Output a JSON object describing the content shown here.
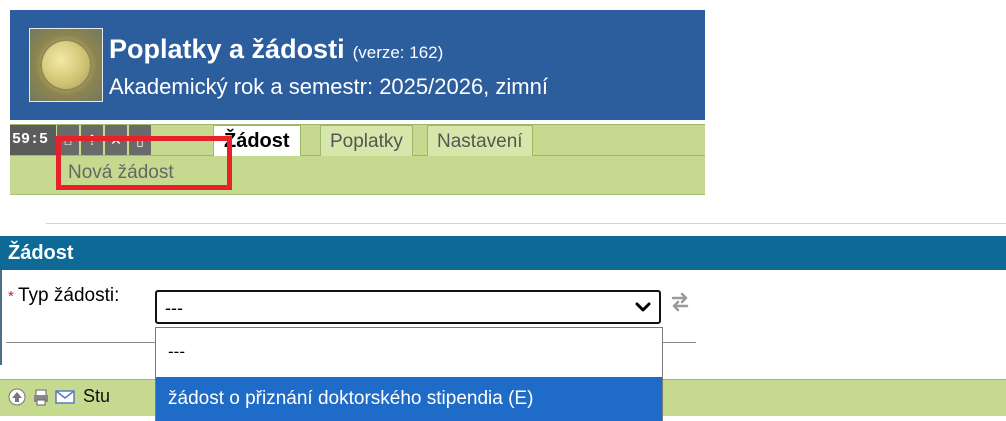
{
  "header": {
    "title": "Poplatky a žádosti",
    "version": "(verze: 162)",
    "term": "Akademický rok a semestr: 2025/2026, zimní"
  },
  "menubar": {
    "timer": "59:5",
    "tools": [
      "home-icon",
      "up-icon",
      "close-icon",
      "print-icon"
    ],
    "tabs": [
      {
        "label": "Žádost",
        "active": true
      },
      {
        "label": "Poplatky",
        "active": false
      },
      {
        "label": "Nastavení",
        "active": false
      }
    ]
  },
  "submenu": {
    "items": [
      "Nová žádost"
    ]
  },
  "section": {
    "title": "Žádost",
    "field_label": "Typ žádosti:",
    "required_marker": "*",
    "select_value": "---",
    "options": [
      "---",
      "žádost o přiznání doktorského stipendia (E)"
    ],
    "highlighted_option_index": 1
  },
  "bottombar": {
    "label": "Stu"
  },
  "colors": {
    "header_bg": "#2c5e9e",
    "menu_bg": "#c5d98f",
    "section_head_bg": "#0f6996",
    "option_highlight": "#1e6cc7",
    "highlight_box": "#e8202a"
  }
}
